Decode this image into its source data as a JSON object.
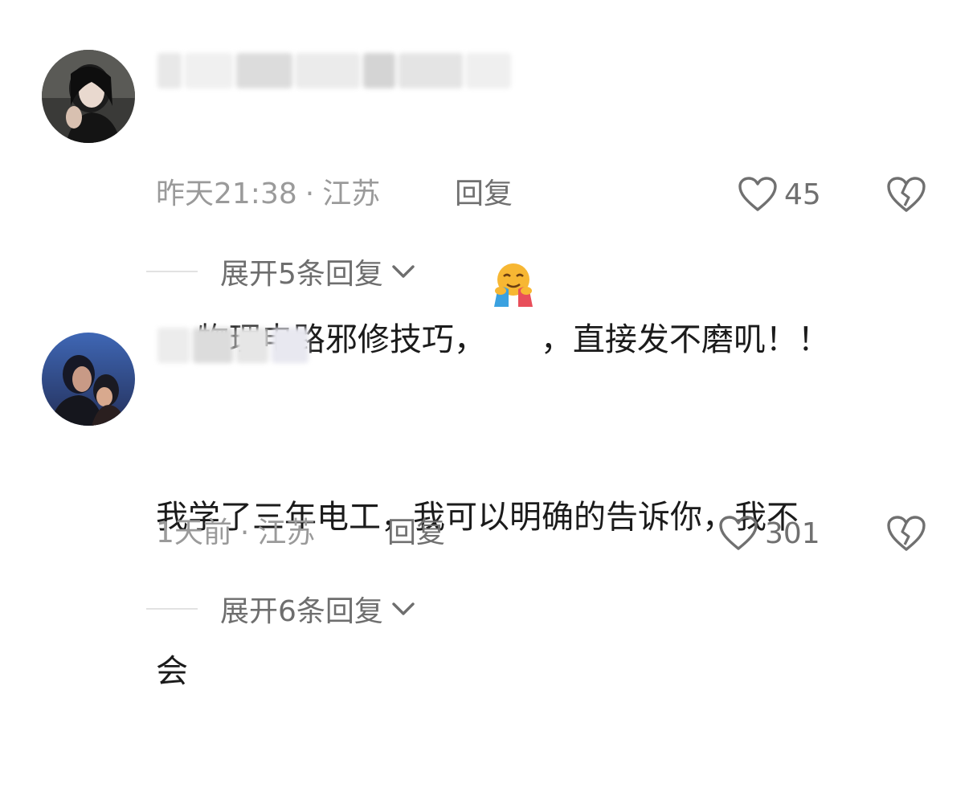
{
  "comments": [
    {
      "avatar_icon": "avatar-woman-dark-photo",
      "text_before_emoji": "物理电路邪修技巧，",
      "emoji_icon": "hugging-face-emoji",
      "text_after_emoji": "，直接发不磨叽！！",
      "time": "昨天21:38",
      "separator": "·",
      "location": "江苏",
      "reply_label": "回复",
      "like_count": "45",
      "expand_label": "展开5条回复"
    },
    {
      "avatar_icon": "avatar-couple-night-photo",
      "text_line1": "我学了三年电工，我可以明确的告诉你，我不",
      "text_line2": "会",
      "time": "1天前",
      "separator": "·",
      "location": "江苏",
      "reply_label": "回复",
      "like_count": "301",
      "expand_label": "展开6条回复"
    }
  ],
  "colors": {
    "meta_gray": "#9a9a9a",
    "action_gray": "#707070",
    "text_dark": "#1b1b1b"
  }
}
